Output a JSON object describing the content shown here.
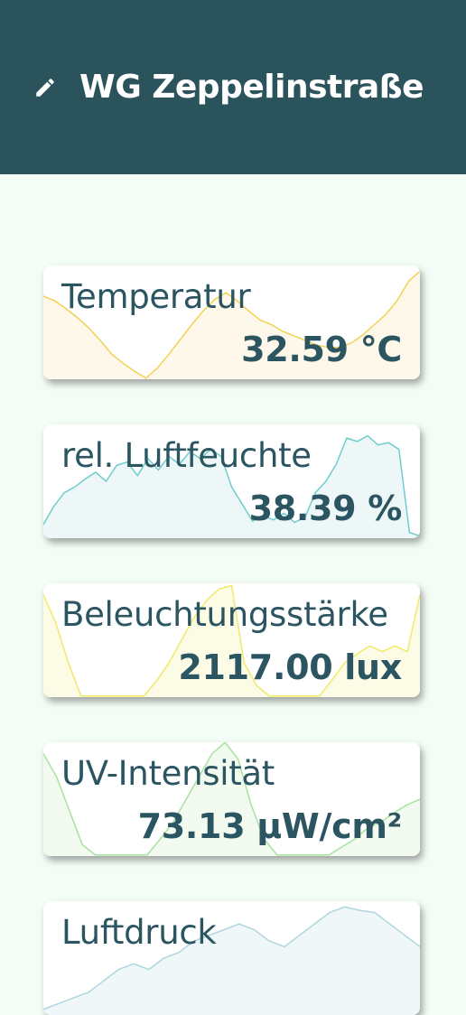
{
  "header": {
    "title": "WG Zeppelinstraße",
    "icon": "pencil-icon",
    "background": "#2b535c"
  },
  "sensors": [
    {
      "id": "temperature",
      "label": "Temperatur",
      "value": "32.59 °C",
      "stroke": "#f2d154",
      "fill": "#fdf8ea",
      "trend": [
        0.27,
        0.31,
        0.38,
        0.46,
        0.55,
        0.66,
        0.78,
        0.86,
        0.93,
        0.99,
        0.9,
        0.78,
        0.65,
        0.52,
        0.4,
        0.3,
        0.24,
        0.31,
        0.4,
        0.48,
        0.52,
        0.58,
        0.62,
        0.66,
        0.7,
        0.72,
        0.72,
        0.68,
        0.61,
        0.52,
        0.43,
        0.31,
        0.14,
        0.05
      ]
    },
    {
      "id": "humidity",
      "label": "rel. Luftfeuchte",
      "value": "38.39 %",
      "stroke": "#6fcccc",
      "fill": "#eef7f8",
      "trend": [
        0.88,
        0.72,
        0.6,
        0.55,
        0.48,
        0.42,
        0.5,
        0.36,
        0.33,
        0.45,
        0.3,
        0.4,
        0.28,
        0.35,
        0.24,
        0.3,
        0.22,
        0.28,
        0.55,
        0.7,
        0.85,
        0.8,
        0.84,
        0.78,
        0.86,
        0.82,
        0.6,
        0.5,
        0.35,
        0.12,
        0.15,
        0.1,
        0.18,
        0.16,
        0.22,
        0.95,
        0.98
      ]
    },
    {
      "id": "illuminance",
      "label": "Beleuchtungsstärke",
      "value": "2117.00 lux",
      "stroke": "#f2e96a",
      "fill": "#fbfbe6",
      "trend": [
        0.1,
        0.35,
        0.7,
        0.99,
        0.99,
        0.99,
        0.99,
        0.99,
        0.99,
        0.86,
        0.7,
        0.5,
        0.3,
        0.15,
        0.05,
        0.02,
        0.7,
        0.9,
        0.99,
        0.99,
        0.99,
        0.99,
        0.99,
        0.85,
        0.7,
        0.62,
        0.55,
        0.6,
        0.55,
        0.6,
        0.1
      ]
    },
    {
      "id": "uv",
      "label": "UV-Intensität",
      "value": "73.13 µW/cm²",
      "stroke": "#a6e3a0",
      "fill": "#f3fbf1",
      "trend": [
        0.1,
        0.3,
        0.6,
        0.9,
        0.99,
        0.99,
        0.99,
        0.99,
        0.99,
        0.85,
        0.7,
        0.5,
        0.3,
        0.1,
        0.0,
        0.15,
        0.55,
        0.85,
        0.99,
        0.99,
        0.99,
        0.99,
        0.99,
        0.92,
        0.85,
        0.75,
        0.7,
        0.62,
        0.55,
        0.5
      ]
    },
    {
      "id": "pressure",
      "label": "Luftdruck",
      "value": "",
      "stroke": "#aed6df",
      "fill": "#f0f7f9",
      "trend": [
        0.95,
        0.9,
        0.85,
        0.8,
        0.7,
        0.6,
        0.55,
        0.6,
        0.5,
        0.45,
        0.35,
        0.3,
        0.25,
        0.2,
        0.25,
        0.35,
        0.4,
        0.3,
        0.2,
        0.1,
        0.05,
        0.08,
        0.1,
        0.2,
        0.3,
        0.4
      ]
    }
  ]
}
